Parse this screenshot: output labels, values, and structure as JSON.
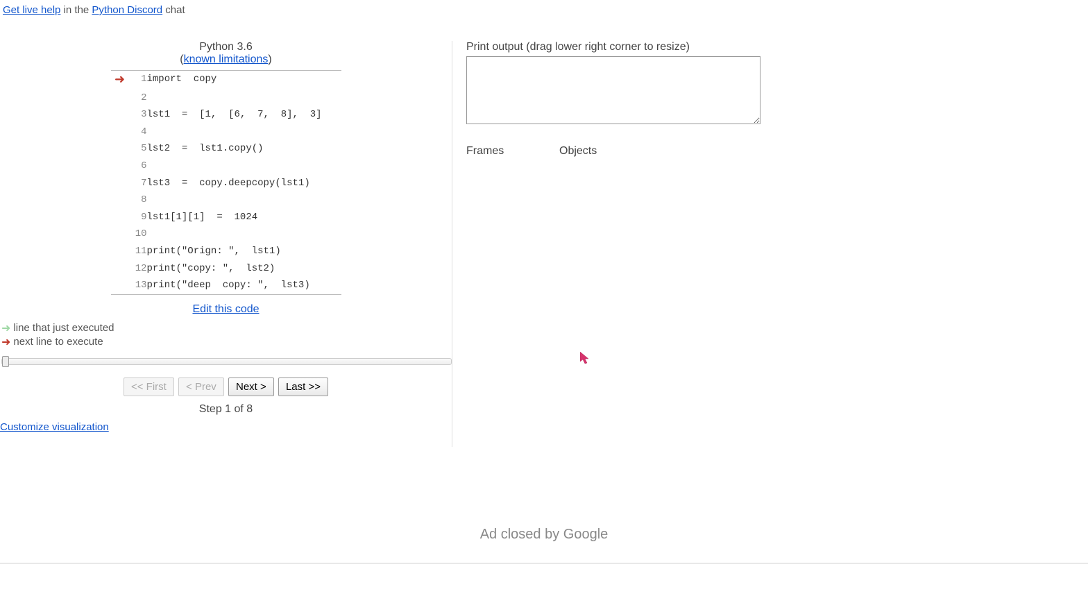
{
  "top_banner": {
    "live_help": "Get live help",
    "in_the": " in the ",
    "discord": "Python Discord",
    "chat": " chat"
  },
  "lang": {
    "name": "Python 3.6",
    "paren_open": "(",
    "limitations": "known limitations",
    "paren_close": ")"
  },
  "code": {
    "lines": [
      "import  copy",
      "",
      "lst1  =  [1,  [6,  7,  8],  3]",
      "",
      "lst2  =  lst1.copy()",
      "",
      "lst3  =  copy.deepcopy(lst1)",
      "",
      "lst1[1][1]  =  1024",
      "",
      "print(\"Orign: \",  lst1)",
      "print(\"copy: \",  lst2)",
      "print(\"deep  copy: \",  lst3)"
    ],
    "current_arrow_line": 1
  },
  "edit_link": "Edit this code",
  "legend": {
    "executed": "line that just executed",
    "next": "next line to execute"
  },
  "controls": {
    "first": "<< First",
    "prev": "< Prev",
    "next": "Next >",
    "last": "Last >>",
    "step_label": "Step 1 of 8"
  },
  "customize": "Customize visualization",
  "output": {
    "label": "Print output (drag lower right corner to resize)",
    "value": ""
  },
  "viz": {
    "frames": "Frames",
    "objects": "Objects"
  },
  "ad": {
    "closed": "Ad closed by ",
    "google": "Google"
  }
}
